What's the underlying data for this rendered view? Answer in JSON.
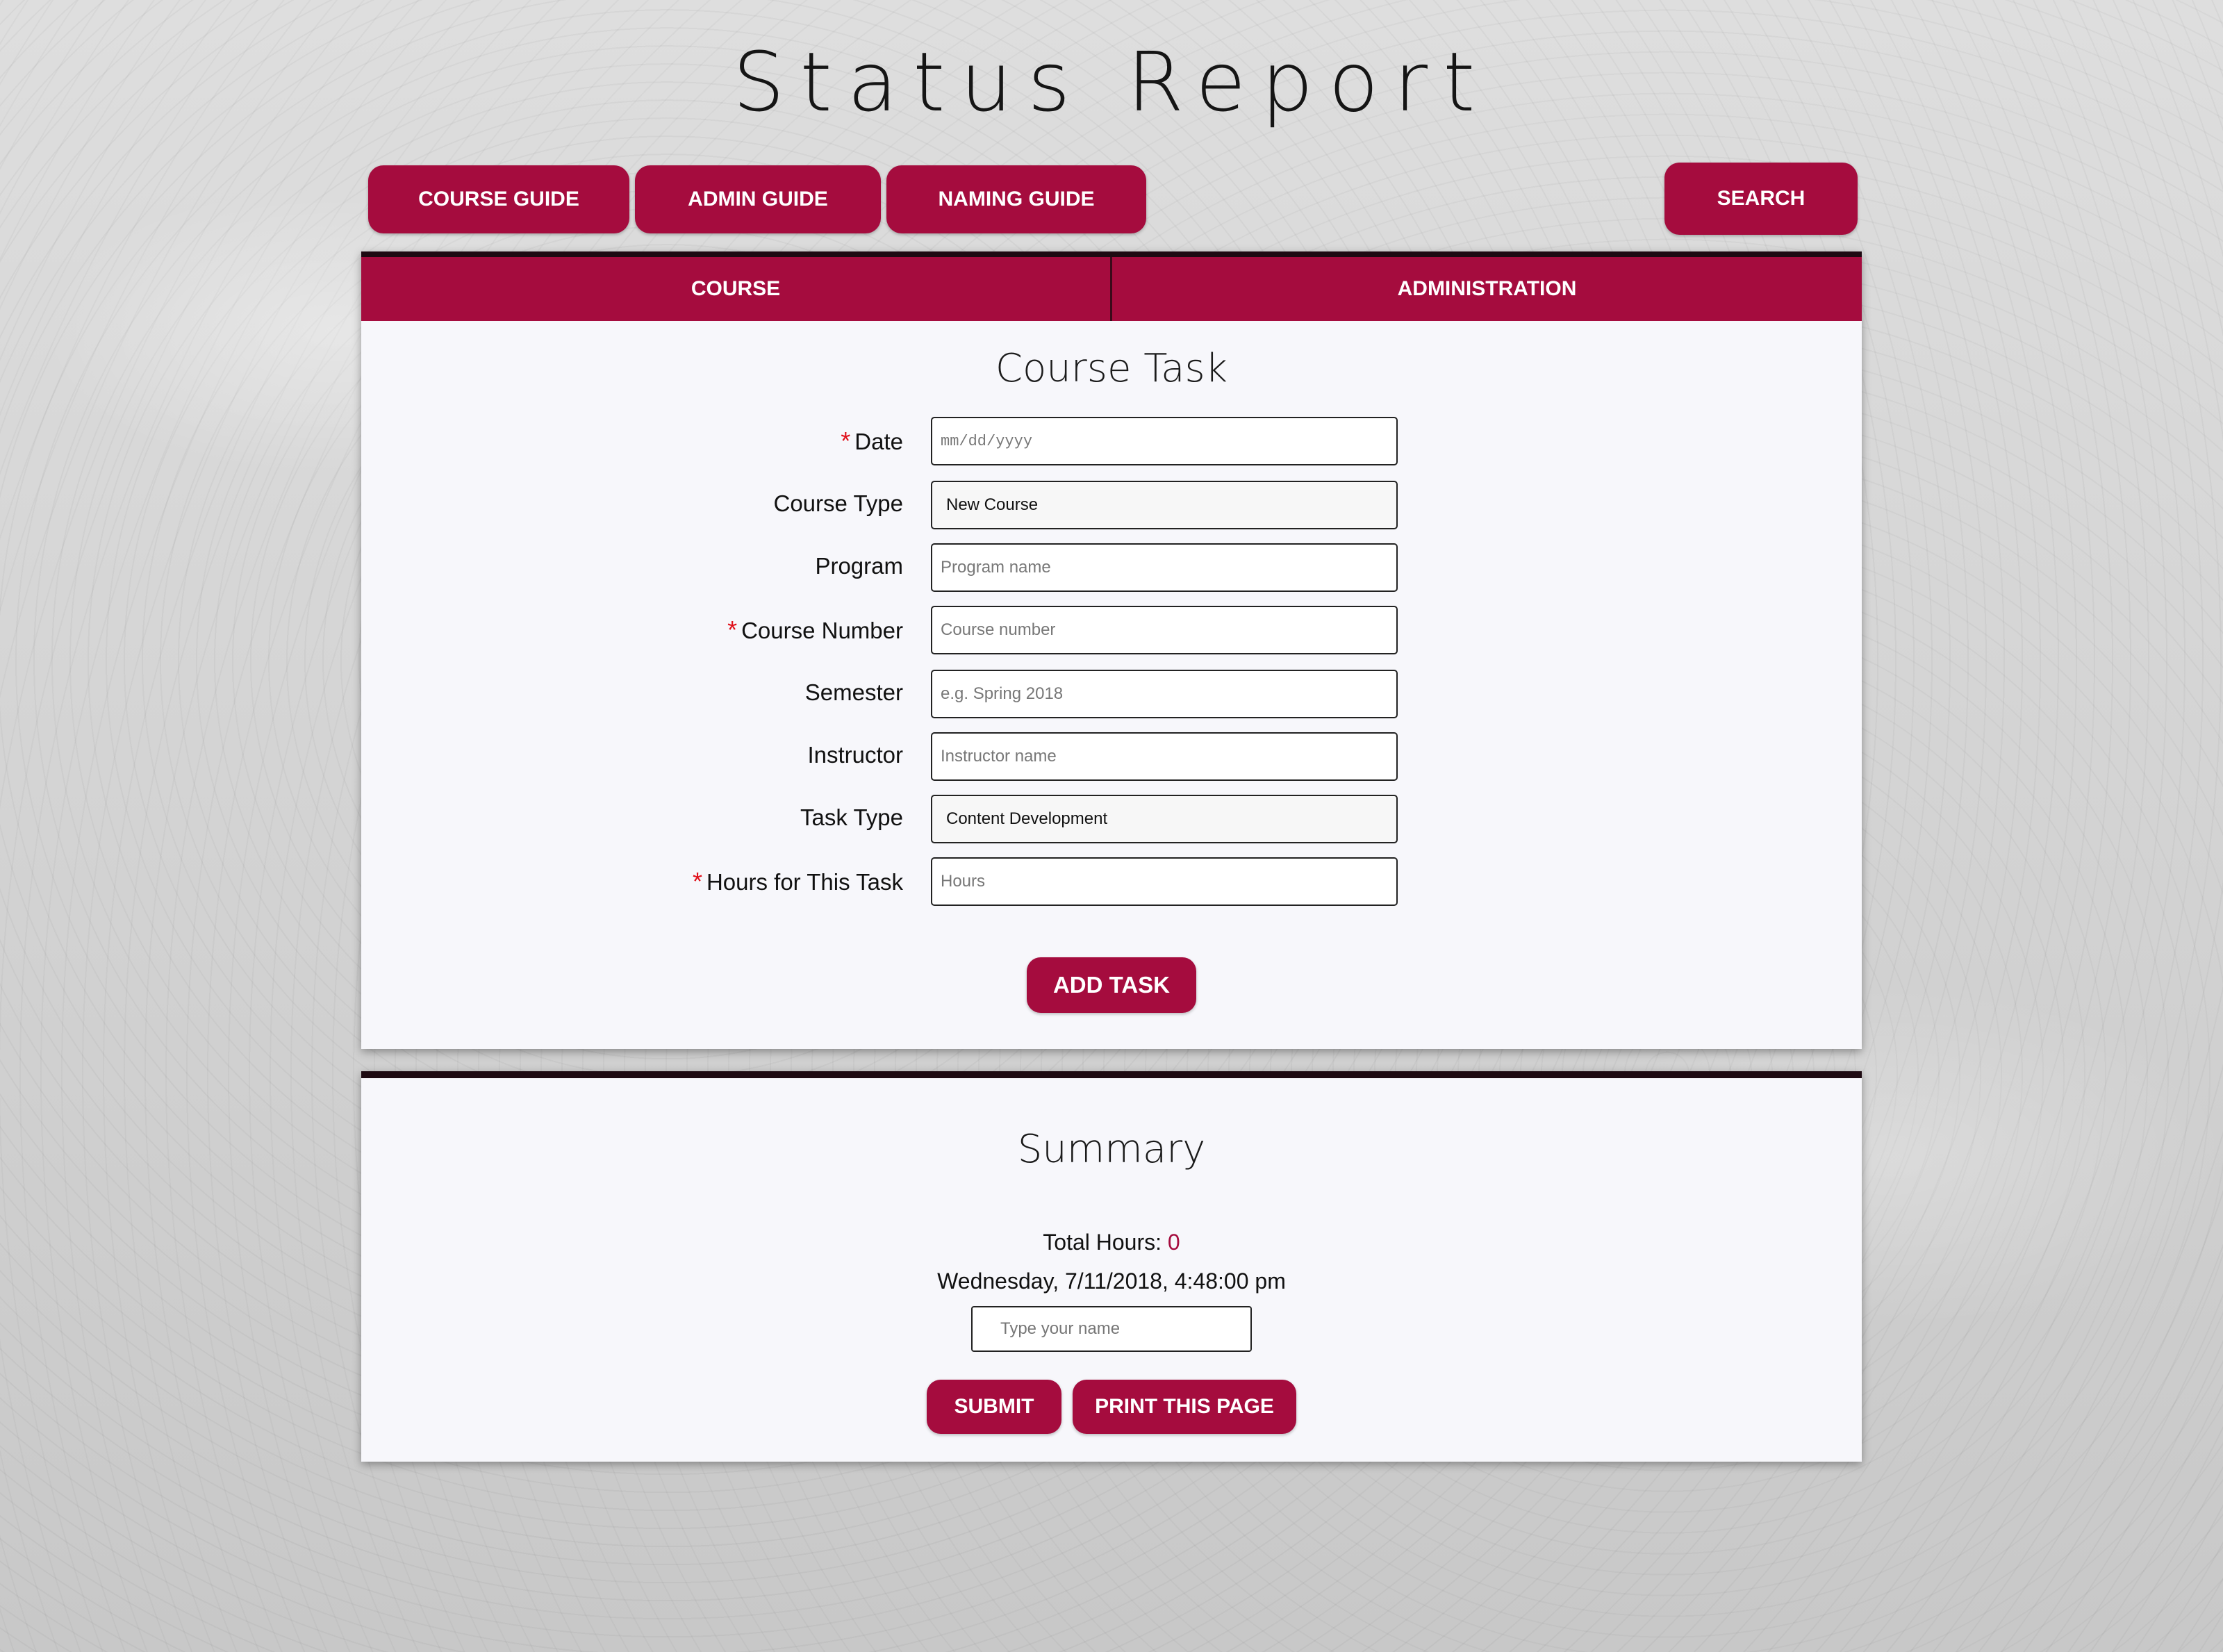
{
  "page": {
    "title": "Status Report"
  },
  "nav": {
    "course_guide": "COURSE GUIDE",
    "admin_guide": "ADMIN GUIDE",
    "naming_guide": "NAMING GUIDE",
    "search": "SEARCH"
  },
  "tabs": {
    "course": "COURSE",
    "administration": "ADMINISTRATION"
  },
  "task_form": {
    "title": "Course Task",
    "date": {
      "label": "Date",
      "required": true,
      "placeholder": "mm/dd/yyyy"
    },
    "course_type": {
      "label": "Course Type",
      "value": "New Course"
    },
    "program": {
      "label": "Program",
      "placeholder": "Program name"
    },
    "course_number": {
      "label": "Course Number",
      "required": true,
      "placeholder": "Course number"
    },
    "semester": {
      "label": "Semester",
      "placeholder": "e.g. Spring 2018"
    },
    "instructor": {
      "label": "Instructor",
      "placeholder": "Instructor name"
    },
    "task_type": {
      "label": "Task Type",
      "value": "Content Development"
    },
    "hours": {
      "label": "Hours for This Task",
      "required": true,
      "placeholder": "Hours"
    },
    "add_button": "ADD TASK",
    "required_marker": "*"
  },
  "summary": {
    "title": "Summary",
    "total_hours_label": "Total Hours:",
    "total_hours_value": "0",
    "datetime": "Wednesday, 7/11/2018, 4:48:00 pm",
    "name_placeholder": "Type your name",
    "submit_button": "SUBMIT",
    "print_button": "PRINT THIS PAGE"
  },
  "colors": {
    "accent": "#a50c3e",
    "required": "#e0101a",
    "card_border": "#1e0a12"
  }
}
